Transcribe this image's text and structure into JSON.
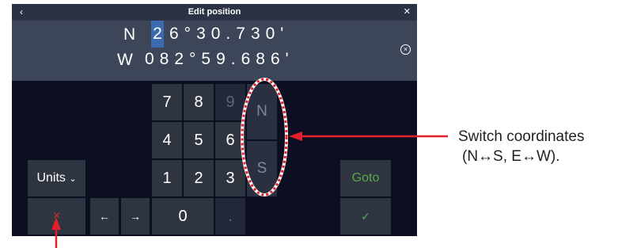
{
  "titlebar": {
    "title": "Edit position",
    "back_glyph": "‹",
    "close_glyph": "✕"
  },
  "coords": {
    "lat_hemisphere": "N",
    "lat_cursor_digit": "2",
    "lat_rest": "6°30.730'",
    "lon_hemisphere": "W",
    "lon_value": "082°59.686'",
    "clear_glyph": "×"
  },
  "keypad": {
    "k7": "7",
    "k8": "8",
    "k9": "9",
    "k4": "4",
    "k5": "5",
    "k6": "6",
    "k1": "1",
    "k2": "2",
    "k3": "3",
    "k0": "0",
    "dot": ".",
    "north": "N",
    "south": "S",
    "units_label": "Units",
    "units_chevron": "⌄",
    "left_arrow": "←",
    "right_arrow": "→",
    "cancel_glyph": "×",
    "goto_label": "Goto",
    "confirm_glyph": "✓"
  },
  "annotation": {
    "line1": "Switch coordinates",
    "line2": "(N↔S, E↔W)."
  },
  "colors": {
    "accent_cursor": "#3b6ab0",
    "annotation_red": "#e0202a",
    "goto_green": "#5aa84a"
  }
}
